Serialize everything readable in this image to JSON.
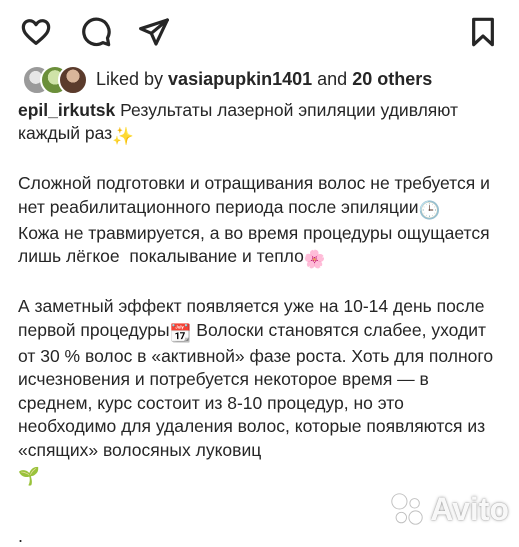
{
  "actions": {
    "like_icon": "heart-icon",
    "comment_icon": "comment-icon",
    "share_icon": "paper-plane-icon",
    "save_icon": "bookmark-icon"
  },
  "likes": {
    "prefix": "Liked by ",
    "user": "vasiapupkin1401",
    "and": " and ",
    "others": "20 others"
  },
  "caption": {
    "username": "epil_irkutsk",
    "line1": " Результаты лазерной эпиляции удивляют каждый раз",
    "para2": "Сложной подготовки и отращивания волос не требуется и нет реабилитационного периода после эпиляции",
    "para3": "Кожа не травмируется, а во время процедуры ощущается лишь лёгкое  покалывание и тепло",
    "para4a": "А заметный эффект появляется уже на 10-14 день после первой процедуры",
    "para4b": " Волоски становятся слабее, уходит от 30 % волос в «активной» фазе роста. Хоть для полного исчезновения и потребуется некоторое время — в среднем, курс состоит из 8-10 процедур, но это необходимо для удаления волос, которые появляются из «спящих» волосяных луковиц",
    "trailing": "."
  },
  "emojis": {
    "sparkles": "✨",
    "clock": "🕒",
    "blossom": "🌸",
    "calendar": "📆",
    "seedling": "🌱"
  },
  "watermark": {
    "text": "Avito"
  }
}
